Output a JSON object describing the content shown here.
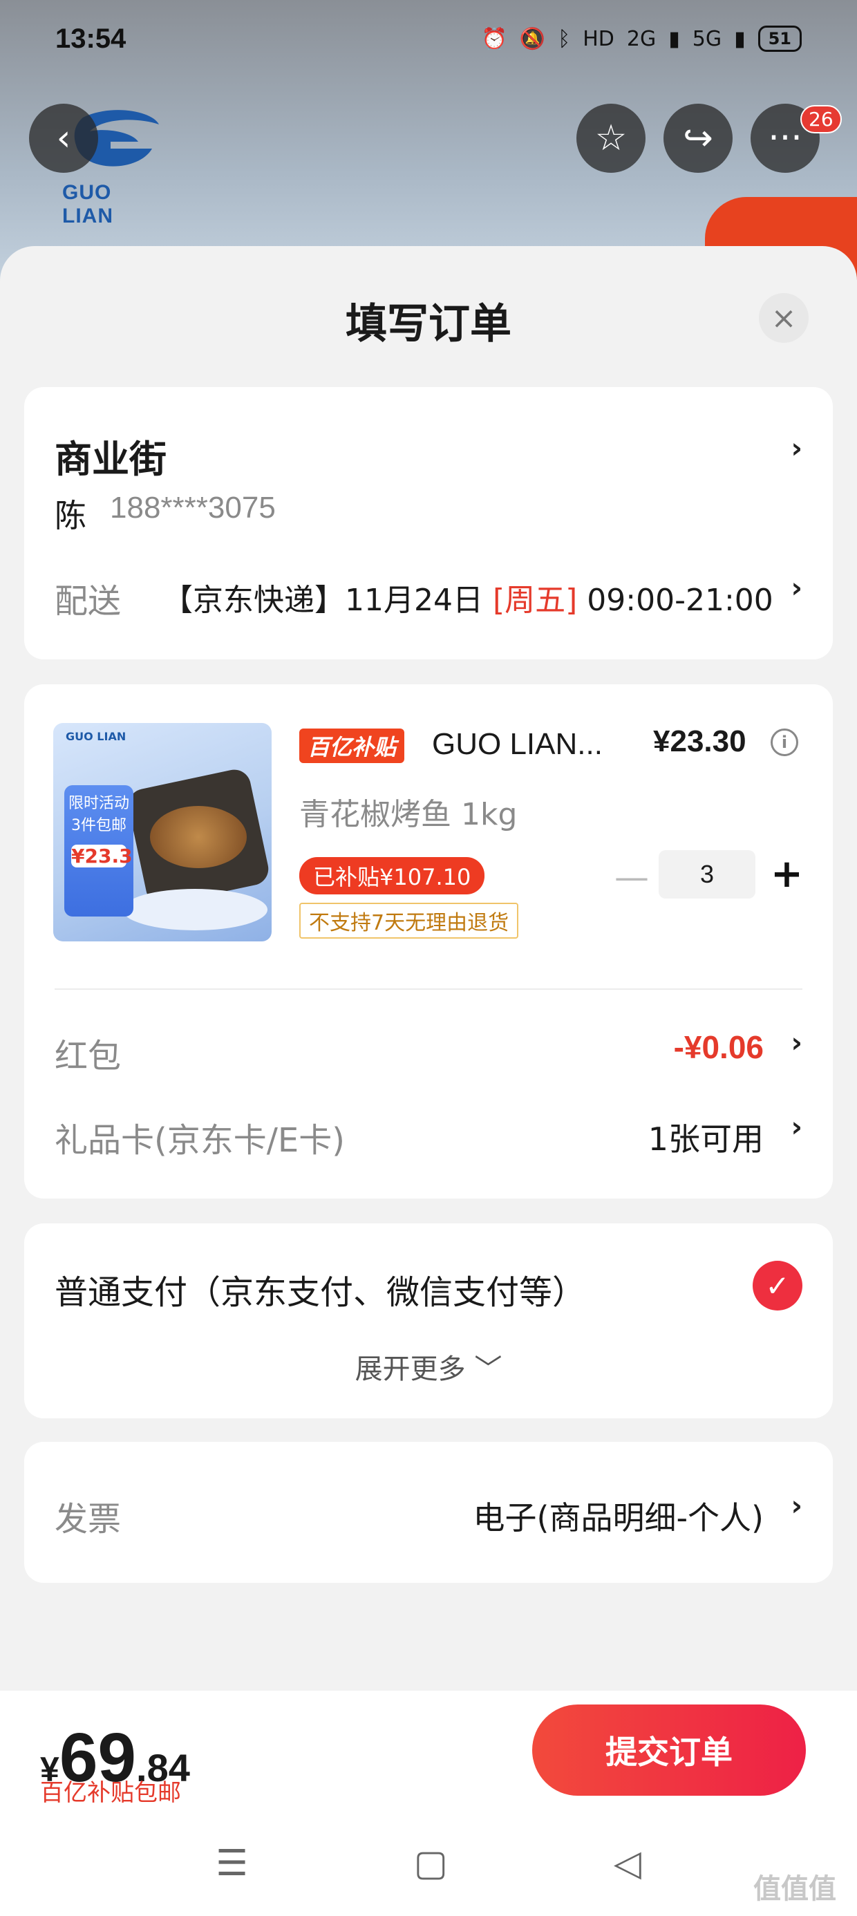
{
  "status_bar": {
    "time": "13:54",
    "network": "2G",
    "network2": "5G",
    "hd": "HD",
    "battery": "51"
  },
  "brand": {
    "logo_text": "GUO LIAN",
    "notification_count": "26"
  },
  "sheet": {
    "title": "填写订单",
    "close": "×"
  },
  "address": {
    "title": "商业街",
    "name": "陈",
    "phone": "188****3075",
    "shipping_label": "配送",
    "shipping_carrier": "【京东快递】11月24日 ",
    "shipping_weekday": "[周五]",
    "shipping_time": " 09:00-21:00"
  },
  "product": {
    "subsidy_tag": "百亿补贴",
    "name": "GUO LIAN...",
    "price": "¥23.30",
    "spec": "青花椒烤鱼 1kg",
    "subsidy_amount": "已补贴¥107.10",
    "no_return": "不支持7天无理由退货",
    "quantity": "3",
    "image_badge": "限时活动",
    "image_badge2": "3件包邮",
    "image_price": "¥23.3",
    "image_logo": "GUO LIAN"
  },
  "red_packet": {
    "label": "红包",
    "value": "-¥0.06"
  },
  "gift_card": {
    "label": "礼品卡(京东卡/E卡)",
    "value": "1张可用"
  },
  "payment": {
    "label": "普通支付（京东支付、微信支付等）",
    "more": "展开更多 ﹀"
  },
  "invoice": {
    "label": "发票",
    "value": "电子(商品明细-个人)"
  },
  "footer": {
    "currency": "¥",
    "total_int": "69",
    "total_dec": ".84",
    "note": "百亿补贴包邮",
    "submit": "提交订单"
  },
  "watermark": "值值值",
  "colors": {
    "accent": "#e53a2b",
    "submit": "#ee2146"
  }
}
